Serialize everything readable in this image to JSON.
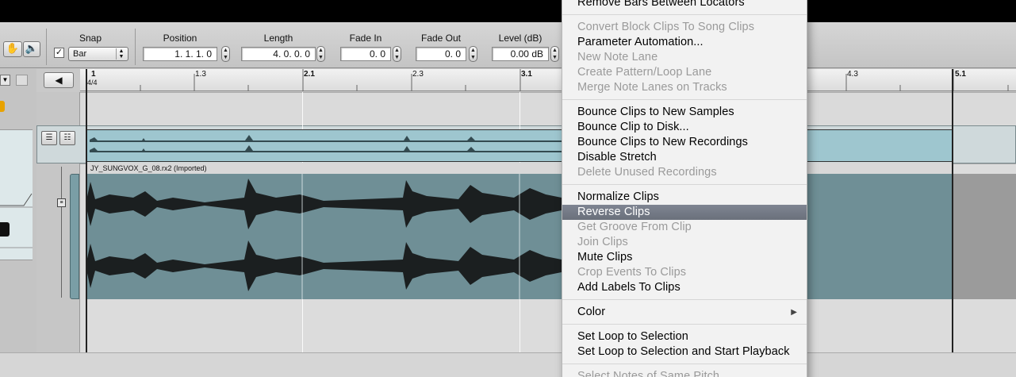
{
  "toolbar": {
    "snap_label": "Snap",
    "snap_value": "Bar",
    "snap_checked": "✓",
    "position_label": "Position",
    "position_value": "1.  1.  1.    0",
    "length_label": "Length",
    "length_value": "4.  0.  0.    0",
    "fade_in_label": "Fade In",
    "fade_in_value": "0.    0",
    "fade_out_label": "Fade Out",
    "fade_out_value": "0.    0",
    "level_label": "Level (dB)",
    "level_value": "0.00 dB"
  },
  "ruler": {
    "signature": "4/4",
    "marks": [
      "1",
      "1.3",
      "2.1",
      "2.3",
      "3.1",
      "4.3",
      "5.1"
    ]
  },
  "clip": {
    "name": "JY_SUNGVOX_G_08.rx2 (Imported)"
  },
  "context_menu": {
    "items": [
      {
        "label": "Remove Bars Between Locators",
        "enabled": true
      },
      {
        "label": "Convert Block Clips To Song Clips",
        "enabled": false
      },
      {
        "label": "Parameter Automation...",
        "enabled": true
      },
      {
        "label": "New Note Lane",
        "enabled": false
      },
      {
        "label": "Create Pattern/Loop Lane",
        "enabled": false
      },
      {
        "label": "Merge Note Lanes on Tracks",
        "enabled": false
      },
      {
        "label": "Bounce Clips to New Samples",
        "enabled": true
      },
      {
        "label": "Bounce Clip to Disk...",
        "enabled": true
      },
      {
        "label": "Bounce Clips to New Recordings",
        "enabled": true
      },
      {
        "label": "Disable Stretch",
        "enabled": true
      },
      {
        "label": "Delete Unused Recordings",
        "enabled": false
      },
      {
        "label": "Normalize Clips",
        "enabled": true
      },
      {
        "label": "Reverse Clips",
        "enabled": true,
        "highlighted": true
      },
      {
        "label": "Get Groove From Clip",
        "enabled": false
      },
      {
        "label": "Join Clips",
        "enabled": false
      },
      {
        "label": "Mute Clips",
        "enabled": true
      },
      {
        "label": "Crop Events To Clips",
        "enabled": false
      },
      {
        "label": "Add Labels To Clips",
        "enabled": true
      },
      {
        "label": "Color",
        "enabled": true,
        "submenu": true
      },
      {
        "label": "Set Loop to Selection",
        "enabled": true
      },
      {
        "label": "Set Loop to Selection and Start Playback",
        "enabled": true
      },
      {
        "label": "Select Notes of Same Pitch",
        "enabled": false
      }
    ]
  },
  "colors": {
    "clip_teal": "#6f8f96",
    "clip_bar": "#9ec6cf",
    "menu_highlight": "#737985"
  },
  "icons": {
    "hand": "hand-tool-icon",
    "speaker": "speaker-tool-icon",
    "play_back": "triangle-left-icon"
  }
}
